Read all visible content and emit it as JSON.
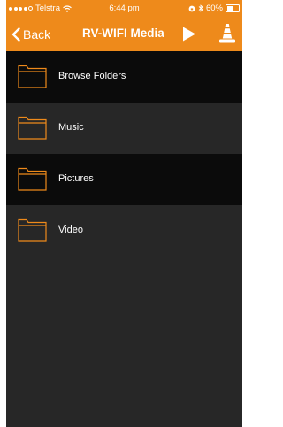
{
  "status_bar": {
    "carrier": "Telstra",
    "time": "6:44 pm",
    "battery_text": "60%",
    "battery_level_percent": 60
  },
  "nav": {
    "back_label": "Back",
    "title": "RV-WIFI Media"
  },
  "list": {
    "items": [
      {
        "label": "Browse Folders",
        "icon": "folder-icon"
      },
      {
        "label": "Music",
        "icon": "folder-icon"
      },
      {
        "label": "Pictures",
        "icon": "folder-icon"
      },
      {
        "label": "Video",
        "icon": "folder-icon"
      }
    ]
  },
  "colors": {
    "accent": "#ee8a1b",
    "row_dark": "#0b0b0b",
    "row_light": "#272727",
    "background": "#272727",
    "text": "#ffffff"
  }
}
